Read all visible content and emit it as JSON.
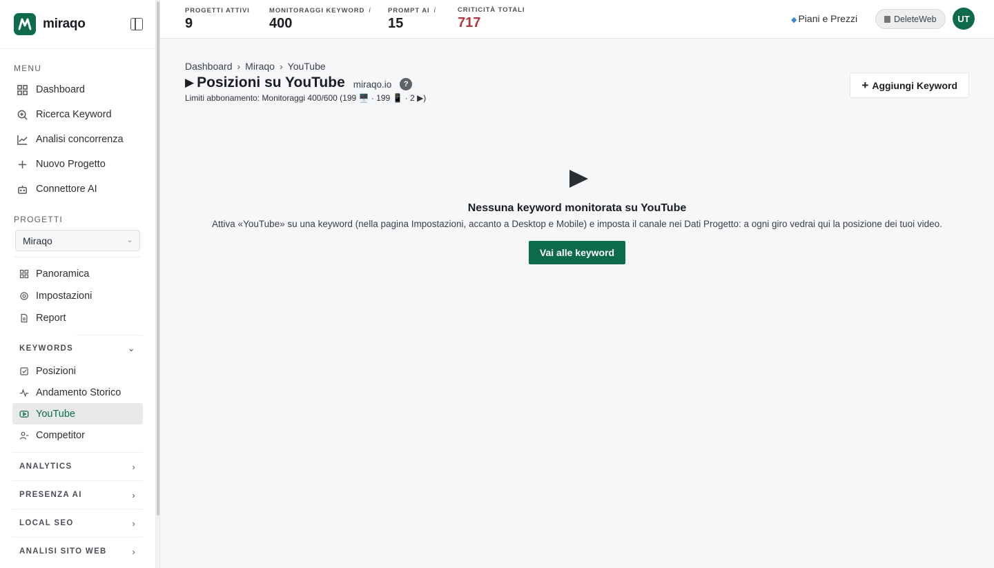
{
  "brand": {
    "name": "miraqo",
    "logo_letter": "M"
  },
  "sidebar": {
    "menu_label": "MENU",
    "menu": [
      {
        "label": "Dashboard",
        "icon": "grid-icon"
      },
      {
        "label": "Ricerca Keyword",
        "icon": "search-icon"
      },
      {
        "label": "Analisi concorrenza",
        "icon": "chart-line-icon"
      },
      {
        "label": "Nuovo Progetto",
        "icon": "plus-icon"
      },
      {
        "label": "Connettore AI",
        "icon": "bot-icon"
      }
    ],
    "projects_label": "PROGETTI",
    "project_selected": "Miraqo",
    "project_items": [
      {
        "label": "Panoramica",
        "icon": "grid-icon"
      },
      {
        "label": "Impostazioni",
        "icon": "gear-icon"
      },
      {
        "label": "Report",
        "icon": "file-icon"
      }
    ],
    "keywords_label": "KEYWORDS",
    "keyword_items": [
      {
        "label": "Posizioni",
        "icon": "check-square-icon"
      },
      {
        "label": "Andamento Storico",
        "icon": "activity-icon"
      },
      {
        "label": "YouTube",
        "icon": "youtube-icon"
      },
      {
        "label": "Competitor",
        "icon": "users-icon"
      }
    ],
    "groups": [
      "ANALYTICS",
      "PRESENZA AI",
      "LOCAL SEO",
      "ANALISI SITO WEB"
    ]
  },
  "topbar": {
    "stats": [
      {
        "label": "PROGETTI ATTIVI",
        "value": "9"
      },
      {
        "label": "MONITORAGGI KEYWORD",
        "value": "400",
        "info": "i"
      },
      {
        "label": "PROMPT AI",
        "value": "15",
        "info": "i"
      },
      {
        "label": "CRITICITÀ TOTALI",
        "value": "717"
      }
    ],
    "plans_label": "Piani e Prezzi",
    "workspace": "DeleteWeb",
    "avatar_initials": "UT"
  },
  "main": {
    "breadcrumb": [
      "Dashboard",
      "Miraqo",
      "YouTube"
    ],
    "title": "Posizioni su YouTube",
    "domain": "miraqo.io",
    "limits": "Limiti abbonamento: Monitoraggi 400/600 (199 🖥️ · 199 📱 · 2 ▶)",
    "add_button": "Aggiungi Keyword",
    "empty_title": "Nessuna keyword monitorata su YouTube",
    "empty_text": "Attiva «YouTube» su una keyword (nella pagina Impostazioni, accanto a Desktop e Mobile) e imposta il canale nei Dati Progetto: a ogni giro vedrai qui la posizione dei tuoi video.",
    "cta": "Vai alle keyword"
  },
  "colors": {
    "brand": "#0e6b4a",
    "danger": "#b5373a"
  }
}
